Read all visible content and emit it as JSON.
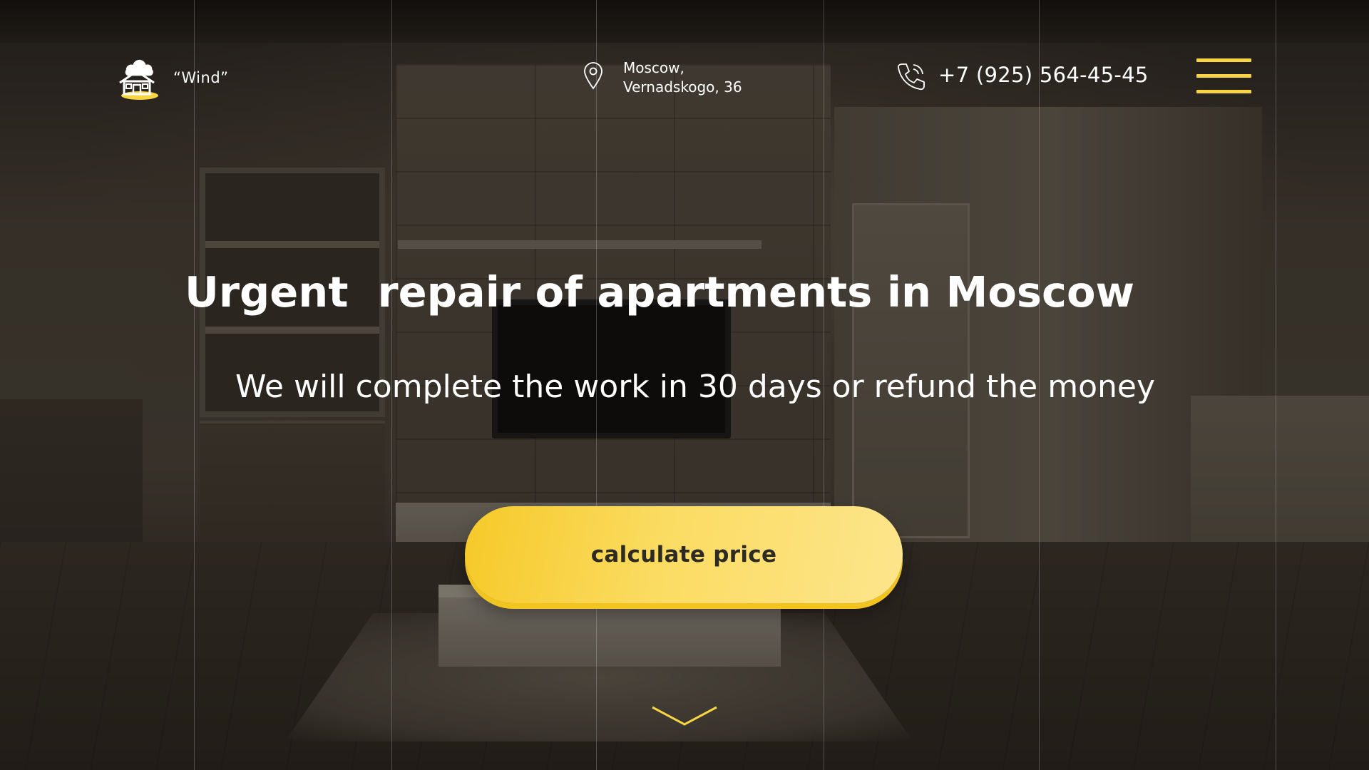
{
  "header": {
    "brand": "“Wind”",
    "address_line1": "Moscow,",
    "address_line2": "Vernadskogo, 36",
    "phone": "+7 (925) 564-45-45",
    "menu_icon": "hamburger-menu-icon"
  },
  "hero": {
    "title": "Urgent  repair of apartments in Moscow",
    "subtitle": "We will complete the work in 30 days or refund the money",
    "cta_label": "calculate price",
    "scroll_icon": "chevron-down-icon"
  },
  "icons": [
    "house-cloud-logo",
    "location-pin-icon",
    "phone-icon",
    "hamburger-menu-icon",
    "chevron-down-icon"
  ],
  "colors": {
    "accent": "#f7d544",
    "button_start": "#f6c928",
    "button_end": "#fde58c",
    "button_text": "#2d2a24",
    "text": "#ffffff"
  }
}
